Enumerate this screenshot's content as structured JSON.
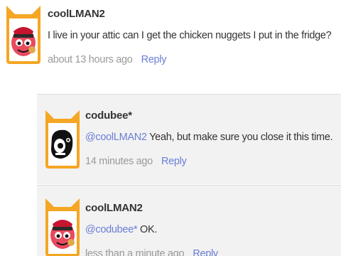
{
  "comments": [
    {
      "username": "coolLMAN2",
      "text": "I live in your attic can I get the chicken nuggets I put in the fridge?",
      "time": "about 13 hours ago",
      "reply_label": "Reply",
      "avatar": "fox-frame-red-cap-avatar-icon"
    },
    {
      "username": "codubee*",
      "mention": "@coolLMAN2",
      "text": " Yeah, but make sure you close it this time.",
      "time": "14 minutes ago",
      "reply_label": "Reply",
      "avatar": "fox-frame-black-white-avatar-icon"
    },
    {
      "username": "coolLMAN2",
      "mention": "@codubee*",
      "text": " OK.",
      "time": "less than a minute ago",
      "reply_label": "Reply",
      "avatar": "fox-frame-red-cap-avatar-icon"
    }
  ],
  "colors": {
    "link": "#6a7ed6",
    "frame_orange": "#f5a623",
    "text": "#333333",
    "meta": "#9a9a9a"
  }
}
